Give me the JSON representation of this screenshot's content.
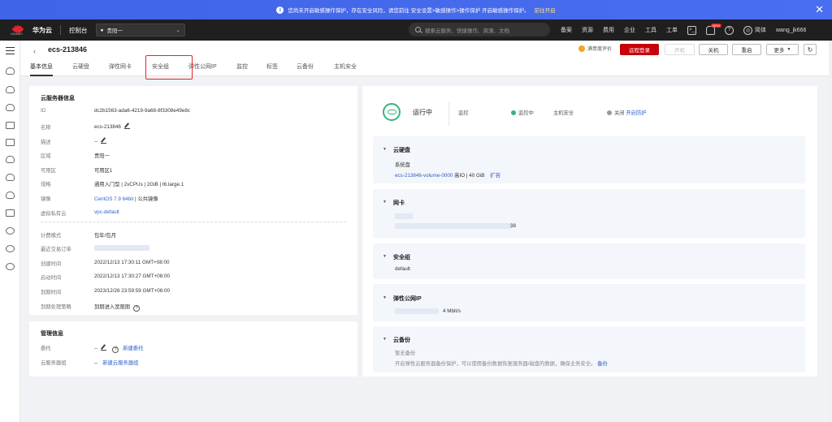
{
  "banner": {
    "message": "您尚未开启敏感操作保护，存在安全风险，请您前往 安全设置>敏感操作>操作保护 开启敏感操作保护。",
    "link": "前往开启"
  },
  "header": {
    "brand": "华为云",
    "logo_text": "HUAWEI",
    "console": "控制台",
    "region": "贵阳一",
    "search_placeholder": "搜索云服务、快捷操作、资源、文档",
    "nav": [
      "备案",
      "资源",
      "费用",
      "企业",
      "工具",
      "工单"
    ],
    "badge": "NEW",
    "lang": "简体",
    "user": "wang_jk666"
  },
  "topbar": {
    "title": "ecs-213846",
    "tabs": [
      "基本信息",
      "云硬盘",
      "弹性网卡",
      "安全组",
      "弹性公网IP",
      "监控",
      "标签",
      "云备份",
      "主机安全"
    ],
    "satisfaction": "满意度评价",
    "buttons": {
      "remote_login": "远程登录",
      "start": "开机",
      "shutdown": "关机",
      "restart": "重启",
      "more": "更多"
    }
  },
  "server_info": {
    "title": "云服务器信息",
    "rows": [
      {
        "label": "ID",
        "value": "dc2b1563-ada6-4219-9a68-8f3308e49e8c"
      },
      {
        "label": "名称",
        "value": "ecs-213846"
      },
      {
        "label": "描述",
        "value": "--"
      },
      {
        "label": "区域",
        "value": "贵阳一"
      },
      {
        "label": "可用区",
        "value": "可用区1"
      },
      {
        "label": "规格",
        "value": "通用入门型 | 2vCPUs | 2GiB | t6.large.1"
      },
      {
        "label": "镜像",
        "value_link": "CentOS 7.9 64bit",
        "value": " | 公共镜像"
      },
      {
        "label": "虚拟私有云",
        "value": "vpc-default"
      }
    ],
    "billing_rows": [
      {
        "label": "计费模式",
        "value": "包年/包月"
      },
      {
        "label": "最近交易订单",
        "value": ""
      },
      {
        "label": "创建时间",
        "value": "2022/12/13 17:30:11 GMT+08:00"
      },
      {
        "label": "启动时间",
        "value": "2022/12/13 17:30:27 GMT+08:00"
      },
      {
        "label": "到期时间",
        "value": "2023/12/26 23:59:59 GMT+08:00"
      },
      {
        "label": "到期处理策略",
        "value": "到期进入宽限期"
      }
    ]
  },
  "mgmt_info": {
    "title": "管理信息",
    "rows": [
      {
        "label": "委托",
        "value": "--",
        "link": "新建委托"
      },
      {
        "label": "云服务器组",
        "value": "--",
        "link": "新建云服务器组"
      }
    ]
  },
  "status": {
    "state": "运行中",
    "monitor_label": "监控",
    "monitor_value": "监控中",
    "hss_label": "主机安全",
    "hss_value": "关闭",
    "hss_link": "开启防护",
    "colors": {
      "running": "#36b37e",
      "off": "#999999"
    }
  },
  "sections": {
    "disk": {
      "title": "云硬盘",
      "subtitle": "系统盘",
      "volume": "ecs-213846-volume-0000",
      "spec": "高IO | 40 GiB",
      "action": "扩容"
    },
    "nic": {
      "title": "网卡",
      "suffix": "38"
    },
    "security_group": {
      "title": "安全组",
      "value": "default"
    },
    "eip": {
      "title": "弹性公网IP",
      "bandwidth": "4 Mbit/s"
    },
    "backup": {
      "title": "云备份",
      "status": "暂无备份",
      "desc": "开启弹性云服务器备份保护，可以使用备份数据恢复服务器/磁盘的数据，确保业务安全。",
      "link": "备份"
    }
  },
  "accent": "#c7000b",
  "link_color": "#2e62c9"
}
